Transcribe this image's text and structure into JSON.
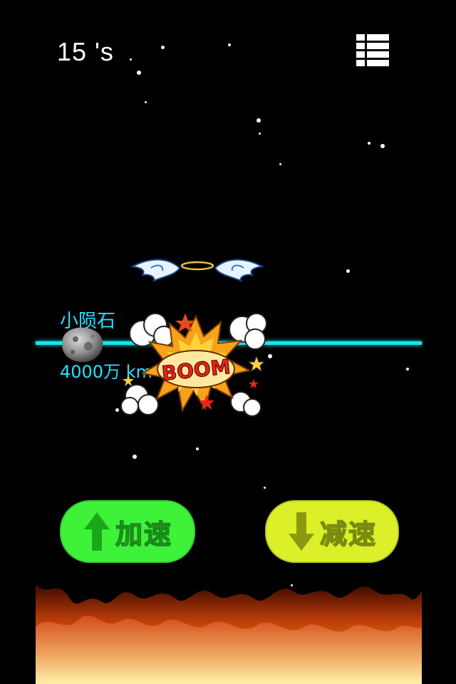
{
  "hud": {
    "timer": "15 's"
  },
  "icons": {
    "menu": "list-menu-icon",
    "accelerate": "arrow-up-icon",
    "decelerate": "arrow-down-icon"
  },
  "asteroid": {
    "name": "小陨石",
    "distance": "4000万 km"
  },
  "effects": {
    "boom_text": "BOOM"
  },
  "controls": {
    "accelerate_label": "加速",
    "decelerate_label": "减速"
  },
  "colors": {
    "background": "#000000",
    "orbit_line": "#14e6f0",
    "asteroid_text": "#28e0ff",
    "accelerate_button": "#3ef23a",
    "decelerate_button": "#dcf02a"
  }
}
